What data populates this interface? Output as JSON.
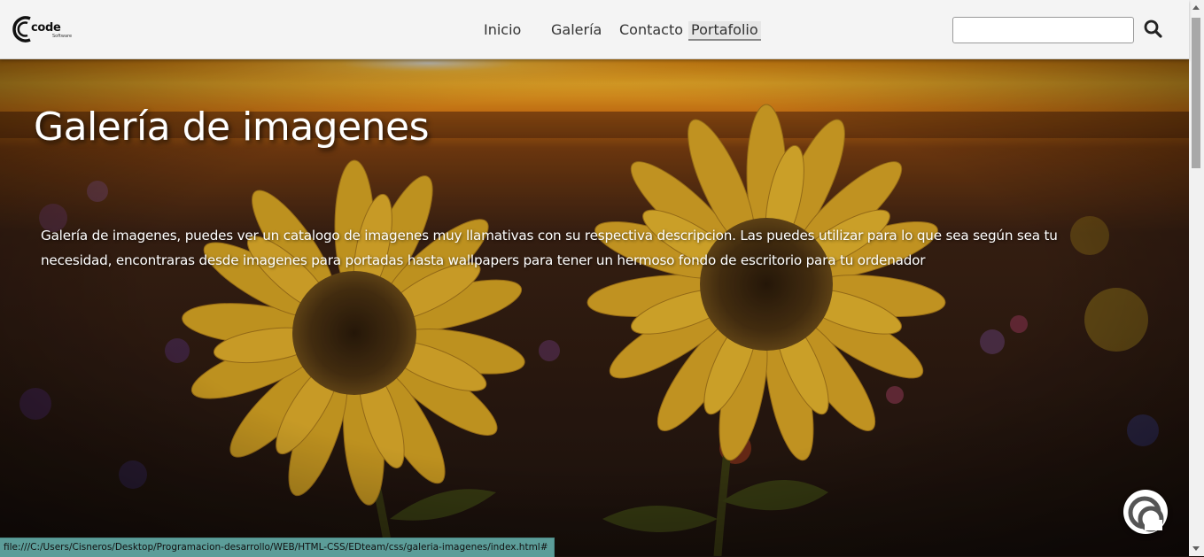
{
  "header": {
    "logo_text": "code",
    "logo_subtext": "Software",
    "nav": [
      {
        "label": "Inicio"
      },
      {
        "label": "Galería"
      },
      {
        "label": "Contacto"
      },
      {
        "label": "Portafolio",
        "active": true
      }
    ],
    "search": {
      "value": "",
      "placeholder": ""
    },
    "search_icon": "search-icon"
  },
  "hero": {
    "title": "Galería de imagenes",
    "description": "Galería de imagenes, puedes ver un catalogo de imagenes muy llamativas con su respectiva descripcion. Las puedes utilizar para lo que sea según sea tu necesidad, encontraras desde imagenes para portadas hasta wallpapers para tener un hermoso fondo de escritorio para tu ordenador",
    "background": "sunflower-field-sunset"
  },
  "status_bar": {
    "url": "file:///C:/Users/Cisneros/Desktop/Programacion-desarrollo/WEB/HTML-CSS/EDteam/css/galeria-imagenes/index.html#"
  },
  "chat_widget": {
    "icon": "chat-icon"
  },
  "colors": {
    "nav_bg": "#f4f4f4",
    "status_bg": "#5c9d99",
    "sky_orange": "#f2a020",
    "petal": "#e8b52a"
  }
}
